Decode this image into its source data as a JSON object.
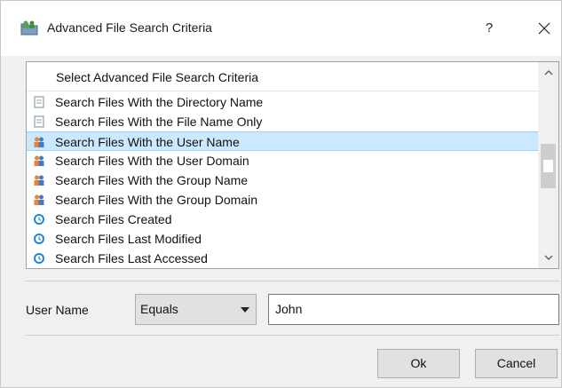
{
  "window": {
    "title": "Advanced File Search Criteria",
    "help_label": "?",
    "icon": "users-folder-icon"
  },
  "criteria_list": {
    "header": "Select Advanced File Search Criteria",
    "items": [
      {
        "label": "Search Files With the Directory Name",
        "icon": "document-icon",
        "selected": false
      },
      {
        "label": "Search Files With the File Name Only",
        "icon": "document-icon",
        "selected": false
      },
      {
        "label": "Search Files With the User Name",
        "icon": "user-group-icon",
        "selected": true
      },
      {
        "label": "Search Files With the User Domain",
        "icon": "user-group-icon",
        "selected": false
      },
      {
        "label": "Search Files With the Group Name",
        "icon": "user-group-icon",
        "selected": false
      },
      {
        "label": "Search Files With the Group Domain",
        "icon": "user-group-icon",
        "selected": false
      },
      {
        "label": "Search Files Created",
        "icon": "clock-icon",
        "selected": false
      },
      {
        "label": "Search Files Last Modified",
        "icon": "clock-icon",
        "selected": false
      },
      {
        "label": "Search Files Last Accessed",
        "icon": "clock-icon",
        "selected": false
      }
    ]
  },
  "criteria": {
    "field_label": "User Name",
    "operator": "Equals",
    "value": "John"
  },
  "buttons": {
    "ok": "Ok",
    "cancel": "Cancel"
  },
  "colors": {
    "selection_bg": "#cce8ff",
    "selection_border": "#99d1ff",
    "clock_blue": "#1e88d6",
    "user_orange": "#e8833a",
    "user_blue": "#4a78c2"
  }
}
